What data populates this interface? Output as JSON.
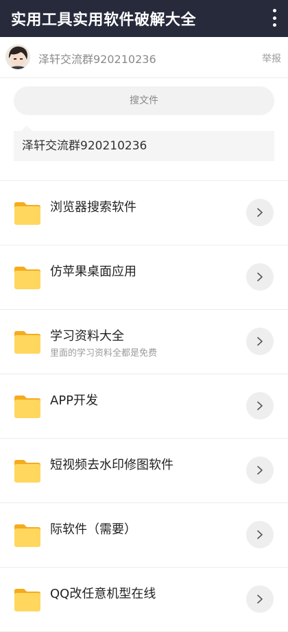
{
  "app": {
    "title": "实用工具实用软件破解大全"
  },
  "owner": {
    "name": "泽轩交流群920210236",
    "report_label": "举报"
  },
  "search": {
    "placeholder": "搜文件"
  },
  "notice": {
    "text": "泽轩交流群920210236"
  },
  "folders": [
    {
      "title": "浏览器搜索软件",
      "subtitle": ""
    },
    {
      "title": "仿苹果桌面应用",
      "subtitle": ""
    },
    {
      "title": "学习资料大全",
      "subtitle": "里面的学习资料全都是免费"
    },
    {
      "title": "APP开发",
      "subtitle": ""
    },
    {
      "title": "短视频去水印修图软件",
      "subtitle": ""
    },
    {
      "title": "际软件（需要）",
      "subtitle": ""
    },
    {
      "title": "QQ改任意机型在线",
      "subtitle": ""
    }
  ],
  "colors": {
    "titlebar_bg": "#272a3b",
    "folder_front": "#ffd75e",
    "folder_back": "#f5ab1e"
  }
}
